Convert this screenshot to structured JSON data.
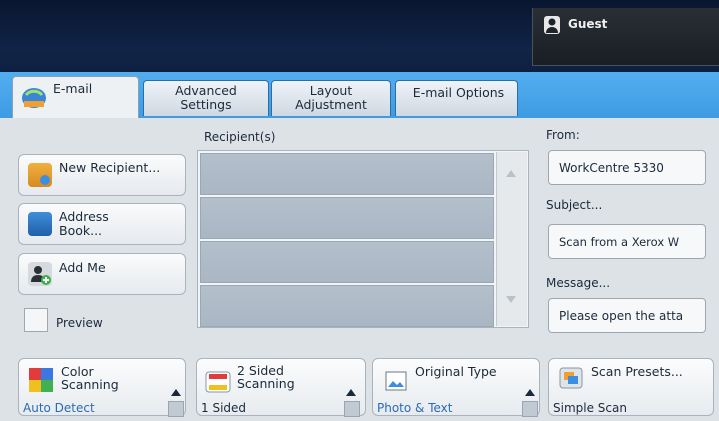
{
  "user": {
    "name": "Guest"
  },
  "tabs": [
    {
      "label": "E-mail"
    },
    {
      "label": "Advanced Settings"
    },
    {
      "label": "Layout Adjustment"
    },
    {
      "label": "E-mail Options"
    }
  ],
  "left_buttons": {
    "new_recipient": "New Recipient...",
    "address_book": "Address Book...",
    "add_me": "Add Me",
    "preview": "Preview"
  },
  "recipients": {
    "header": "Recipient(s)",
    "rows": [
      "",
      "",
      "",
      ""
    ]
  },
  "right_panel": {
    "from_label": "From:",
    "from_value": "WorkCentre 5330",
    "subject_label": "Subject...",
    "subject_value": "Scan from a Xerox W",
    "message_label": "Message...",
    "message_value": "Please open the atta"
  },
  "features": {
    "color": {
      "title": "Color Scanning",
      "value": "Auto Detect"
    },
    "sides": {
      "title": "2 Sided Scanning",
      "value": "1 Sided"
    },
    "original": {
      "title": "Original Type",
      "value": "Photo & Text"
    },
    "presets": {
      "title": "Scan Presets...",
      "value": "Simple Scan"
    }
  },
  "colors": {
    "tab_strip": "#4aa6ec",
    "value_text": "#2a6bb5",
    "top_bar": "#0e1f3d"
  }
}
